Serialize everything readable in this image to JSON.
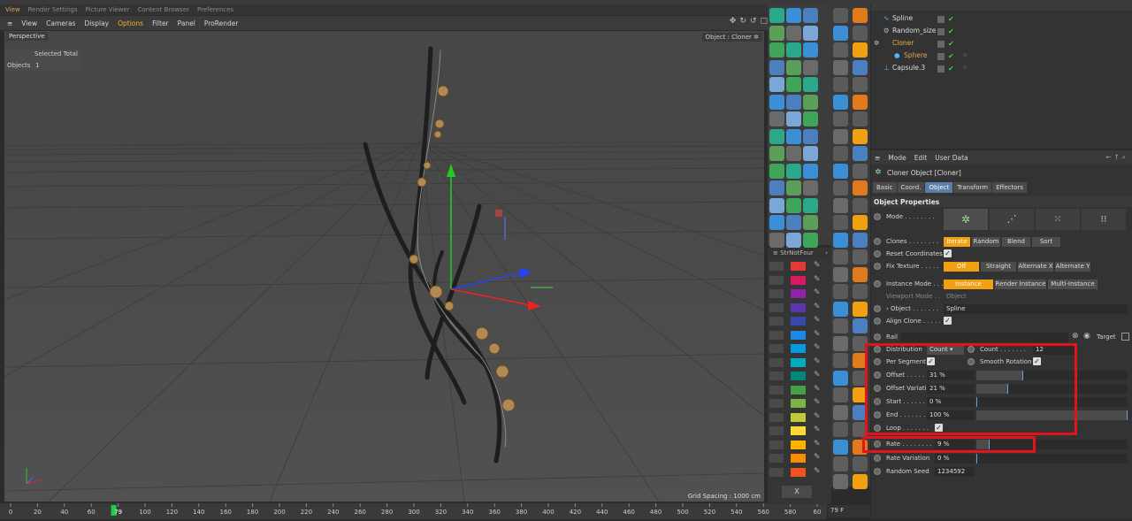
{
  "render_tabs": [
    "View",
    "Render Settings",
    "Picture Viewer",
    "Content Browser",
    "Preferences"
  ],
  "viewport_menu": [
    "View",
    "Cameras",
    "Display",
    "Options",
    "Filter",
    "Panel",
    "ProRender"
  ],
  "viewport": {
    "camera": "Perspective",
    "selected_total_label": "Selected Total",
    "objects_label": "Objects",
    "objects_count": "1",
    "active_object": "Object : Cloner",
    "grid_spacing": "Grid Spacing : 1000 cm"
  },
  "timeline": {
    "ticks": [
      "0",
      "20",
      "40",
      "60",
      "79",
      "100",
      "120",
      "140",
      "160",
      "180",
      "200",
      "220",
      "240",
      "260",
      "280",
      "300",
      "320",
      "340",
      "360",
      "380",
      "400",
      "420",
      "440",
      "460",
      "480",
      "500",
      "520",
      "540",
      "560",
      "580",
      "60"
    ],
    "current_frame": "79",
    "frame_readout": "79 F"
  },
  "swatches": {
    "header": "StrNotFour",
    "colors": [
      "#e53935",
      "#d81b60",
      "#8e24aa",
      "#5e35b1",
      "#3949ab",
      "#1e88e5",
      "#039be5",
      "#00acc1",
      "#00897b",
      "#43a047",
      "#7cb342",
      "#c0ca33",
      "#fdd835",
      "#ffb300",
      "#fb8c00",
      "#f4511e"
    ],
    "close_label": "X"
  },
  "object_manager": {
    "objects": [
      {
        "name": "Spline"
      },
      {
        "name": "Random_size"
      },
      {
        "name": "Cloner"
      },
      {
        "name": "Sphere"
      },
      {
        "name": "Capsule.3"
      }
    ]
  },
  "attributes": {
    "menu": [
      "Mode",
      "Edit",
      "User Data"
    ],
    "title": "Cloner Object [Cloner]",
    "tabs": [
      "Basic",
      "Coord.",
      "Object",
      "Transform",
      "Effectors"
    ],
    "section": "Object Properties",
    "mode_label": "Mode . . . . . . . .",
    "clones_label": "Clones . . . . . . . .",
    "clones_options": [
      "Iterate",
      "Random",
      "Blend",
      "Sort"
    ],
    "reset_coords_label": "Reset Coordinates",
    "fix_texture_label": "Fix Texture . . . . .",
    "fix_texture_options": [
      "Off",
      "Straight",
      "Alternate X",
      "Alternate Y"
    ],
    "instance_mode_label": "Instance Mode . . .",
    "instance_mode_options": [
      "Instance",
      "Render Instance",
      "Multi-Instance"
    ],
    "viewport_mode_label": "Viewport Mode . .",
    "viewport_mode_value": "Object",
    "object_label": "› Object . . . . . . .",
    "object_value": "Spline",
    "align_clone_label": "Align Clone . . . . .",
    "rail_label": "Rail . . . . . . . . . .",
    "target_label": "Target",
    "distribution_label": "Distribution",
    "distribution_value": "Count",
    "count_label": "Count . . . . . . .",
    "count_value": "12",
    "per_segment_label": "Per Segment",
    "smooth_rotation_label": "Smooth Rotation",
    "offset": {
      "label": "Offset . . . . . . .",
      "value": "31 %",
      "fraction": 0.31
    },
    "offset_variation": {
      "label": "Offset Variation",
      "value": "21 %",
      "fraction": 0.21
    },
    "start": {
      "label": "Start . . . . . . .",
      "value": "0 %",
      "fraction": 0
    },
    "end": {
      "label": "End . . . . . . . .",
      "value": "100 %",
      "fraction": 1.0
    },
    "loop_label": "Loop . . . . . . .",
    "rate": {
      "label": "Rate . . . . . . . .",
      "value": "9 %",
      "fraction": 0.09
    },
    "rate_variation": {
      "label": "Rate Variation",
      "value": "0 %",
      "fraction": 0
    },
    "random_seed_label": "Random Seed",
    "random_seed_value": "1234592"
  },
  "colors": {
    "accent": "#f0a010",
    "highlight": "#e0141a",
    "active_tab": "#5a7ea8"
  }
}
